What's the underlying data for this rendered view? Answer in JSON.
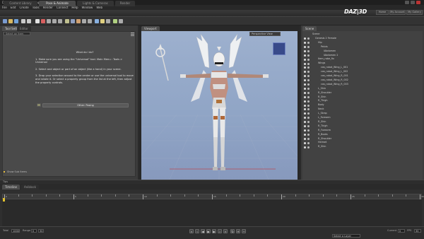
{
  "window": {
    "title": "DAZ Studio 4.7 Pro - Seraphim.duf"
  },
  "menu": [
    "File",
    "Edit",
    "Create",
    "Tools",
    "Render",
    "Connect",
    "Help",
    "Window",
    "Web"
  ],
  "main_tabs": [
    {
      "label": "Content Library"
    },
    {
      "label": "Pose & Animate"
    },
    {
      "label": "Lights & Cameras"
    },
    {
      "label": "Render"
    }
  ],
  "brand": {
    "logo": "DAZ|3D",
    "links": [
      "Home",
      "My Account",
      "My Gallery"
    ]
  },
  "left_pane": {
    "tabs": [
      "Tool Settings",
      "Editor"
    ],
    "select_item": "Select an Item",
    "instructions_title": "What do I do?",
    "steps": [
      "1. Make sure you are using the \"Universal\" tool. Main Menu : Tools > Universal",
      "2. Select and object or part of an object (like a hand) in your scene.",
      "3. Drop your selection around to the center or use the universal tool to move and rotate it. Or select a property group from the list at the left, then adjust the property controls."
    ],
    "command_button": "Other: Posing",
    "show_sub_items": "Show Sub Items"
  },
  "viewport": {
    "tab": "Viewport",
    "camera": "Perspective View"
  },
  "scene": {
    "tab": "Scene",
    "rows": [
      "Scene",
      "Genesis 2 Female",
      "Hip",
      "Pelvis",
      "lAbdomen",
      "lAbdomen 2",
      "Item_robe_fix",
      "Wings",
      "cas_robot_Wing_L_001",
      "cas_robot_Wing_L_002",
      "cas_robot_Wing_R_001",
      "cas_robot_Wing_R_002",
      "cas_robot_Wing_R_003",
      "L_Shin",
      "R_Shoulder",
      "R_Shin",
      "R_Thigh",
      "Body",
      "Neck",
      "L_Strap",
      "L_Forearm",
      "R_Shin",
      "R_Thigh",
      "R_Forearm",
      "R_Boots",
      "R_Shoulder",
      "Helmet",
      "R_Shin"
    ]
  },
  "help_bar": "Tips",
  "timeline": {
    "tabs": [
      "Timeline",
      "Aniblock"
    ],
    "tick_labels": [
      "0",
      "5",
      "10",
      "15",
      "20",
      "25",
      "30"
    ],
    "total_label": "Total",
    "total_value": "1000",
    "range_label": "Range",
    "range_start": "0",
    "range_end": "30",
    "current_label": "Current",
    "current_value": "0",
    "fps_label": "FPS",
    "fps_value": "30",
    "method_label": "Select a Layer"
  },
  "colors": {
    "accent": "#e0c030",
    "viewport_bg": "#9db0ce",
    "panel": "#3b3b3b"
  }
}
